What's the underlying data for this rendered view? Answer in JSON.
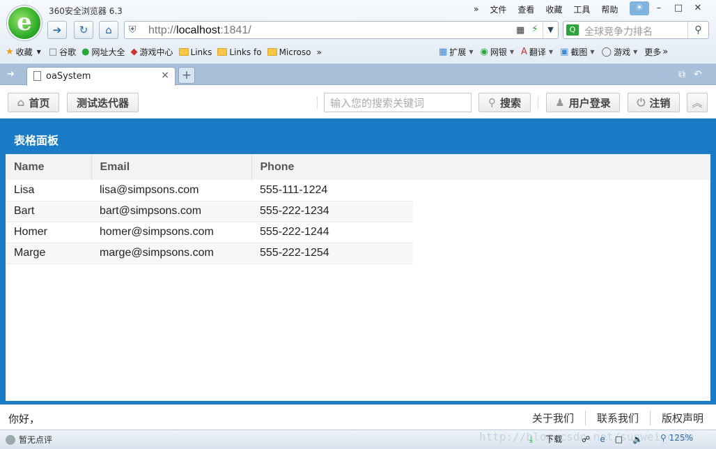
{
  "browser": {
    "title": "360安全浏览器 6.3",
    "logo_letter": "e",
    "menu": [
      "»",
      "文件",
      "查看",
      "收藏",
      "工具",
      "帮助"
    ],
    "window_controls": [
      "skin-icon",
      "minimize-icon",
      "maximize-icon",
      "close-icon"
    ],
    "address": {
      "prefix": "http://",
      "host": "localhost",
      "suffix": ":1841/"
    },
    "search_placeholder": "全球竞争力排名",
    "favorites": [
      {
        "label": "收藏",
        "icon": "star-icon"
      },
      {
        "label": "谷歌",
        "icon": "page-icon"
      },
      {
        "label": "网址大全",
        "icon": "globe-icon"
      },
      {
        "label": "游戏中心",
        "icon": "gamepad-icon"
      },
      {
        "label": "Links",
        "icon": "folder-icon"
      },
      {
        "label": "Links fo",
        "icon": "folder-icon"
      },
      {
        "label": "Microso",
        "icon": "folder-icon"
      }
    ],
    "favorites_more": "»",
    "tools": [
      {
        "label": "扩展",
        "icon": "extension-icon"
      },
      {
        "label": "网银",
        "icon": "bank-icon"
      },
      {
        "label": "翻译",
        "icon": "translate-icon"
      },
      {
        "label": "截图",
        "icon": "screenshot-icon"
      },
      {
        "label": "游戏",
        "icon": "game-icon"
      },
      {
        "label": "更多",
        "icon": "more-icon"
      }
    ],
    "tab": {
      "label": "oaSystem",
      "close": "×"
    },
    "new_tab": "+"
  },
  "page": {
    "nav": {
      "home_label": "首页",
      "iterator_label": "测试迭代器",
      "search_placeholder": "输入您的搜索关键词",
      "search_label": "搜索",
      "login_label": "用户登录",
      "logout_label": "注销",
      "collapse_label": "︽"
    },
    "panel_title": "表格面板",
    "table": {
      "columns": [
        "Name",
        "Email",
        "Phone"
      ],
      "rows": [
        [
          "Lisa",
          "lisa@simpsons.com",
          "555-111-1224"
        ],
        [
          "Bart",
          "bart@simpsons.com",
          "555-222-1234"
        ],
        [
          "Homer",
          "homer@simpsons.com",
          "555-222-1244"
        ],
        [
          "Marge",
          "marge@simpsons.com",
          "555-222-1254"
        ]
      ]
    },
    "footer": {
      "greeting": "你好，",
      "links": [
        "关于我们",
        "联系我们",
        "版权声明"
      ]
    }
  },
  "statusbar": {
    "rating": "暂无点评",
    "download": "下载",
    "zoom": "125%",
    "watermark": "http://blog.csdn.net/sunwei_csdn"
  },
  "colors": {
    "panel": "#1a7cc7",
    "tab_strip": "#a8c0da"
  }
}
